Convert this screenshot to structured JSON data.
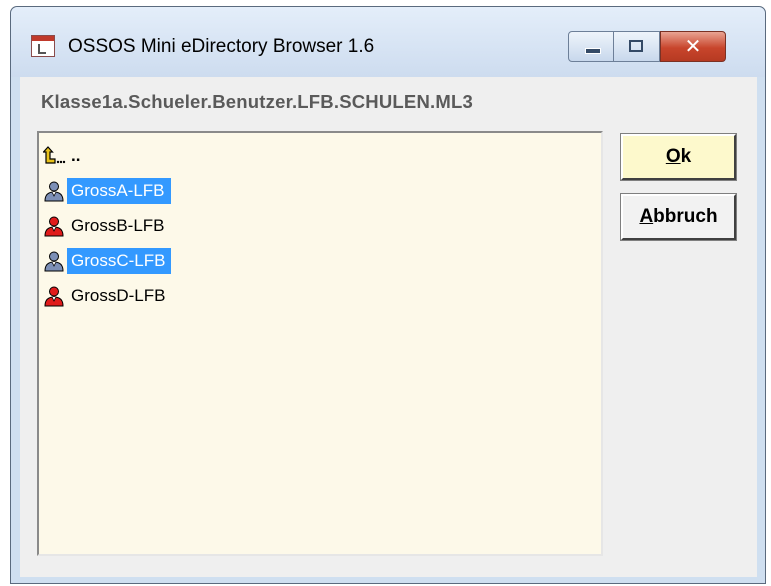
{
  "window": {
    "title": "OSSOS Mini eDirectory Browser 1.6",
    "controls": {
      "minimize_icon": "minimize-icon",
      "maximize_icon": "maximize-icon",
      "close_icon": "close-icon",
      "close_glyph": "✕"
    }
  },
  "path": "Klasse1a.Schueler.Benutzer.LFB.SCHULEN.ML3",
  "list": {
    "parent": {
      "label": "..",
      "icon": "up-arrow-icon"
    },
    "items": [
      {
        "label": "GrossA-LFB",
        "selected": true,
        "icon": "user-icon"
      },
      {
        "label": "GrossB-LFB",
        "selected": false,
        "icon": "user-icon"
      },
      {
        "label": "GrossC-LFB",
        "selected": true,
        "icon": "user-icon"
      },
      {
        "label": "GrossD-LFB",
        "selected": false,
        "icon": "user-icon"
      }
    ]
  },
  "buttons": {
    "ok": {
      "mnemonic": "O",
      "rest": "k"
    },
    "cancel": {
      "mnemonic": "A",
      "rest": "bbruch"
    }
  },
  "colors": {
    "list_bg": "#fdf9e9",
    "selection": "#3399ff",
    "ok_bg": "#fdf9cc",
    "close_red": "#c8452c"
  }
}
